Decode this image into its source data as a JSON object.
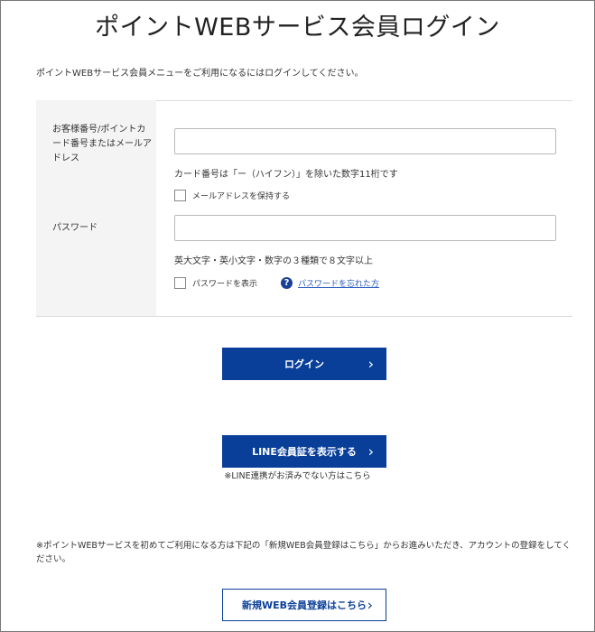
{
  "page": {
    "title": "ポイントWEBサービス会員ログイン",
    "intro": "ポイントWEBサービス会員メニューをご利用になるにはログインしてください。"
  },
  "form": {
    "id_label": "お客様番号/ポイントカード番号またはメールアドレス",
    "id_value": "",
    "id_hint": "カード番号は「ー（ハイフン）」を除いた数字11桁です",
    "remember_email_label": "メールアドレスを保持する",
    "password_label": "パスワード",
    "password_value": "",
    "password_hint": "英大文字・英小文字・数字の３種類で８文字以上",
    "show_password_label": "パスワードを表示",
    "help_icon": "question-circle-icon",
    "help_glyph": "?",
    "forgot_password_link": "パスワードを忘れた方"
  },
  "buttons": {
    "login": "ログイン",
    "line": "LINE会員証を表示する",
    "register": "新規WEB会員登録はこちら",
    "chevron": "›"
  },
  "notes": {
    "line_note": "※LINE連携がお済みでない方はこちら",
    "first_time": "※ポイントWEBサービスを初めてご利用になる方は下記の「新規WEB会員登録はこちら」からお進みいただき、アカウントの登録をしてください。"
  },
  "colors": {
    "primary": "#0a3f99",
    "link": "#2a5bbf",
    "panel_bg": "#f4f4f4"
  }
}
